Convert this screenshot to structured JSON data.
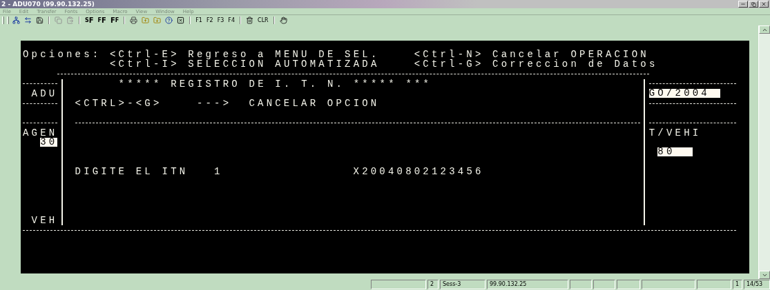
{
  "window": {
    "title": "2 - ADU070 (99.90.132.25)"
  },
  "menu": [
    "File",
    "Edit",
    "Transfer",
    "Fonts",
    "Options",
    "Macro",
    "View",
    "Window",
    "Help"
  ],
  "toolbar": {
    "font_buttons": [
      {
        "kind": "small-big",
        "small": "S",
        "big": "F"
      },
      {
        "kind": "small-big",
        "small": "F",
        "big": "F"
      },
      {
        "kind": "big-small",
        "small": "F",
        "big": "F"
      }
    ],
    "keys": [
      "F1",
      "F2",
      "F3",
      "F4"
    ],
    "clear": "CLR"
  },
  "terminal": {
    "options_label": "Opciones:",
    "options": [
      {
        "key": "<Ctrl-E>",
        "label": "Regreso a MENU DE SEL."
      },
      {
        "key": "<Ctrl-N>",
        "label": "Cancelar OPERACION"
      },
      {
        "key": "<Ctrl-I>",
        "label": "SELECCION AUTOMATIZADA"
      },
      {
        "key": "<Ctrl-G>",
        "label": "Correccion de Datos"
      }
    ],
    "left": {
      "adu": "ADU",
      "agen": "AGEN",
      "agen_value": "30",
      "veh": "VEH"
    },
    "title": "***** REGISTRO DE I. T. N. ***** ***",
    "cancel": {
      "key": "<CTRL>-<G>",
      "arrow": "--->",
      "label": "CANCELAR OPCION"
    },
    "itn": {
      "label": "DIGITE EL ITN",
      "index": "1",
      "value": "X20040802123456"
    },
    "right": {
      "date_value": "GO/2004",
      "tveh": "T/VEHI",
      "tveh_value": "80"
    }
  },
  "status_bar": [
    "2",
    "Sess-3",
    "99.90.132.25",
    "1",
    "14/53"
  ]
}
